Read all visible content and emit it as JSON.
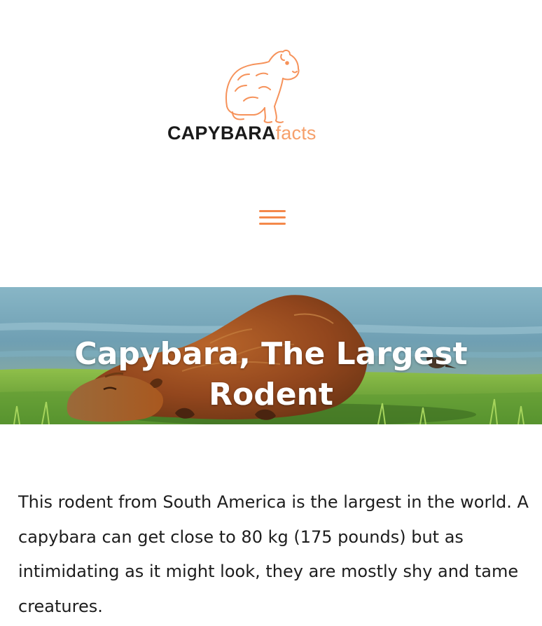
{
  "site": {
    "logo": {
      "brand_text": "CAPYBARA",
      "suffix_text": "facts",
      "mascot_icon": "capybara-outline-icon",
      "brand_color": "#1a1a1a",
      "accent_color": "#f6a06b"
    },
    "menu": {
      "icon": "hamburger-menu-icon",
      "color": "#f4884a"
    }
  },
  "hero": {
    "title_line1": "Capybara, The Largest",
    "title_line2": "Rodent",
    "image_subject": "capybara-lying-on-grass-photo"
  },
  "article": {
    "intro": "This rodent from South America is the largest in the world. A capybara can get close to 80 kg (175 pounds) but as intimidating as it might look, they are mostly shy and tame creatures."
  }
}
